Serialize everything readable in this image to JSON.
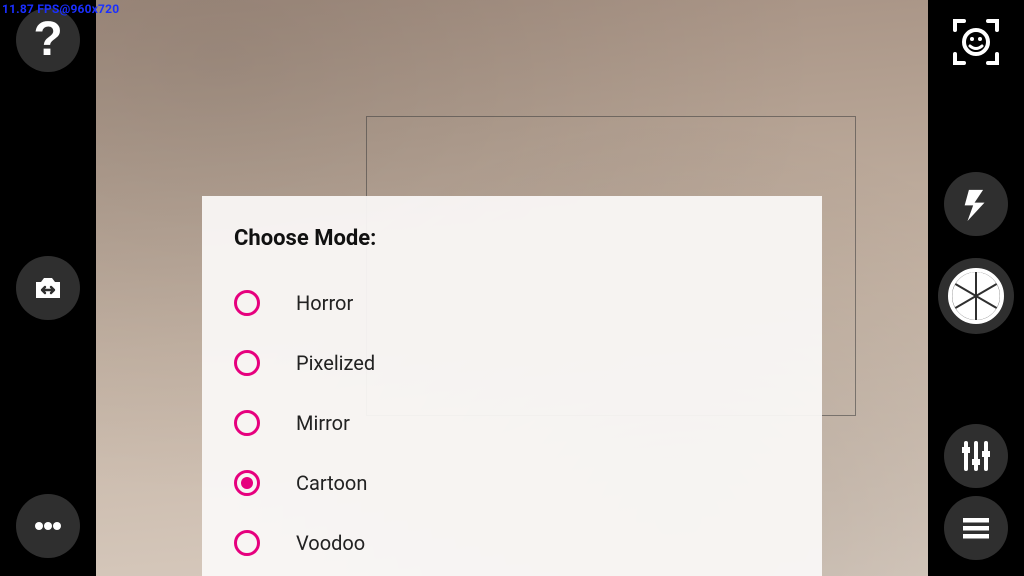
{
  "debug_overlay": "11.87 FPS@960x720",
  "sheet": {
    "title": "Choose Mode:",
    "options": [
      {
        "label": "Horror",
        "selected": false
      },
      {
        "label": "Pixelized",
        "selected": false
      },
      {
        "label": "Mirror",
        "selected": false
      },
      {
        "label": "Cartoon",
        "selected": true
      },
      {
        "label": "Voodoo",
        "selected": false
      }
    ]
  },
  "colors": {
    "accent": "#e6007e"
  },
  "icons": {
    "help": "help-icon",
    "switch_camera": "switch-camera-icon",
    "more": "more-icon",
    "face_detect": "face-detect-icon",
    "flash": "flash-icon",
    "shutter": "shutter-icon",
    "sliders": "sliders-icon",
    "menu": "menu-icon"
  }
}
